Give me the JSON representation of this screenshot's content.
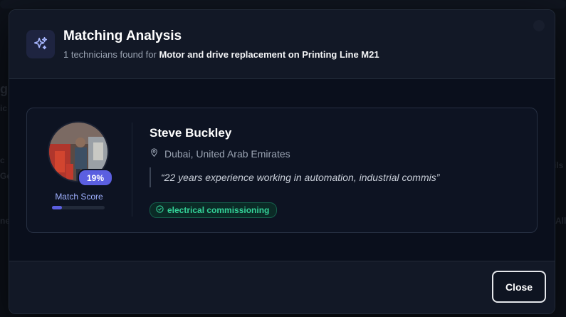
{
  "modal": {
    "title": "Matching Analysis",
    "subtitle_prefix": "1 technicians found for",
    "task": "Motor and drive replacement on Printing Line M21",
    "icon": "sparkles-icon",
    "close_label": "Close"
  },
  "technician": {
    "name": "Steve Buckley",
    "location": "Dubai, United Arab Emirates",
    "quote": "“22 years experience working in automation, industrial commis”",
    "match_score_label": "19%",
    "match_score_fraction": 0.19,
    "match_score_caption": "Match Score",
    "skill_tag": "electrical commissioning"
  },
  "colors": {
    "accent": "#5b5fe0",
    "tag_green": "#34d399",
    "background": "#0a0f1c"
  }
}
